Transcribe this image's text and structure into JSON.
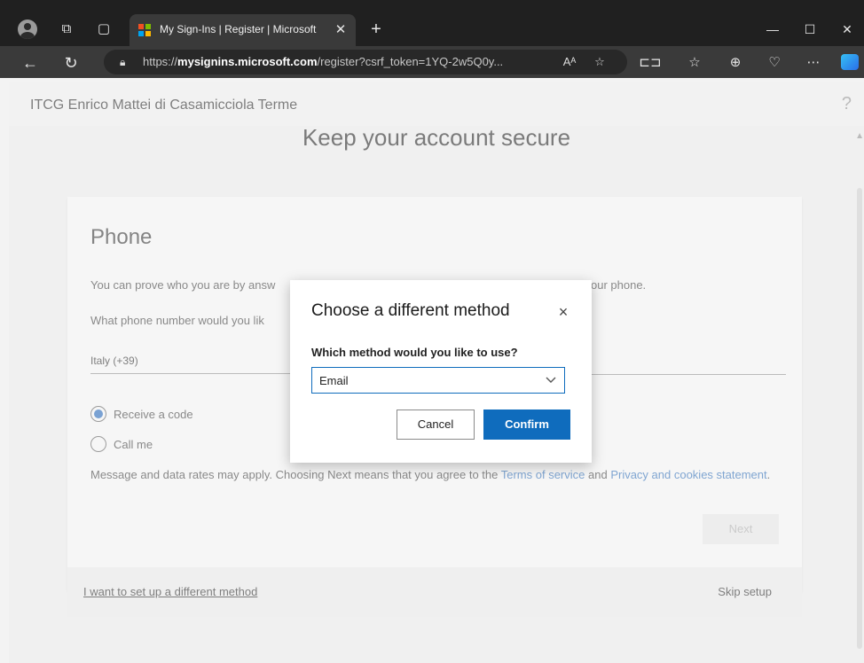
{
  "browser": {
    "tab_title": "My Sign-Ins | Register | Microsoft",
    "url_prefix": "https://",
    "url_host": "mysignins.microsoft.com",
    "url_path": "/register?csrf_token=1YQ-2w5Q0y...",
    "read_aloud_label": "Aᴬ"
  },
  "header": {
    "org_name": "ITCG Enrico Mattei di Casamicciola Terme",
    "help": "?"
  },
  "page": {
    "title": "Keep your account secure"
  },
  "phone_card": {
    "heading": "Phone",
    "desc_left": "You can prove who you are by answ",
    "desc_right": "our phone.",
    "question": "What phone number would you lik",
    "country_value": "Italy (+39)",
    "radio_receive": "Receive a code",
    "radio_call": "Call me",
    "legal_text": "Message and data rates may apply. Choosing Next means that you agree to the ",
    "terms_link": "Terms of service",
    "and_text": " and ",
    "privacy_link": "Privacy and cookies statement",
    "period": ".",
    "next_label": "Next"
  },
  "footer": {
    "alt_method": "I want to set up a different method",
    "skip": "Skip setup"
  },
  "modal": {
    "title": "Choose a different method",
    "close": "×",
    "label": "Which method would you like to use?",
    "selected": "Email",
    "cancel": "Cancel",
    "confirm": "Confirm"
  },
  "colors": {
    "accent": "#0f6cbd",
    "link": "#2364b0"
  }
}
